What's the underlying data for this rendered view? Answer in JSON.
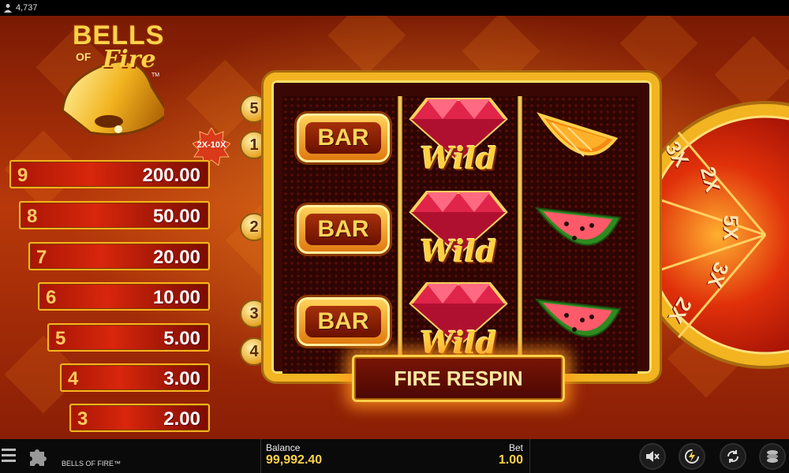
{
  "topbar": {
    "player_count": "4,737"
  },
  "logo": {
    "word1": "BELLS",
    "word2": "OF",
    "word3": "Fire",
    "tm": "TM"
  },
  "multiplier_badge": "2X-10X",
  "paytable": [
    {
      "count": "9",
      "amount": "200.00"
    },
    {
      "count": "8",
      "amount": "50.00"
    },
    {
      "count": "7",
      "amount": "20.00"
    },
    {
      "count": "6",
      "amount": "10.00"
    },
    {
      "count": "5",
      "amount": "5.00"
    },
    {
      "count": "4",
      "amount": "3.00"
    },
    {
      "count": "3",
      "amount": "2.00"
    }
  ],
  "line_markers": [
    "5",
    "1",
    "2",
    "3",
    "4"
  ],
  "reels": {
    "reel1": [
      "BAR",
      "BAR",
      "BAR"
    ],
    "reel2": [
      "Wild",
      "Wild",
      "Wild"
    ],
    "reel3": [
      "orange",
      "watermelon",
      "watermelon"
    ]
  },
  "wheel": {
    "labels": [
      "3X",
      "2X",
      "5X",
      "3X",
      "2X"
    ]
  },
  "fire_respin_label": "FIRE RESPIN",
  "bottombar": {
    "game_name": "BELLS OF FIRE™",
    "balance_label": "Balance",
    "balance_value": "99,992.40",
    "bet_label": "Bet",
    "bet_value": "1.00"
  },
  "icons": [
    "user-icon",
    "menu-icon",
    "puzzle-icon",
    "sound-off-icon",
    "turbo-icon",
    "autoplay-icon",
    "coins-icon"
  ],
  "colors": {
    "gold": "#f2b420",
    "red": "#d8260c",
    "dark": "#0a0a0a"
  }
}
